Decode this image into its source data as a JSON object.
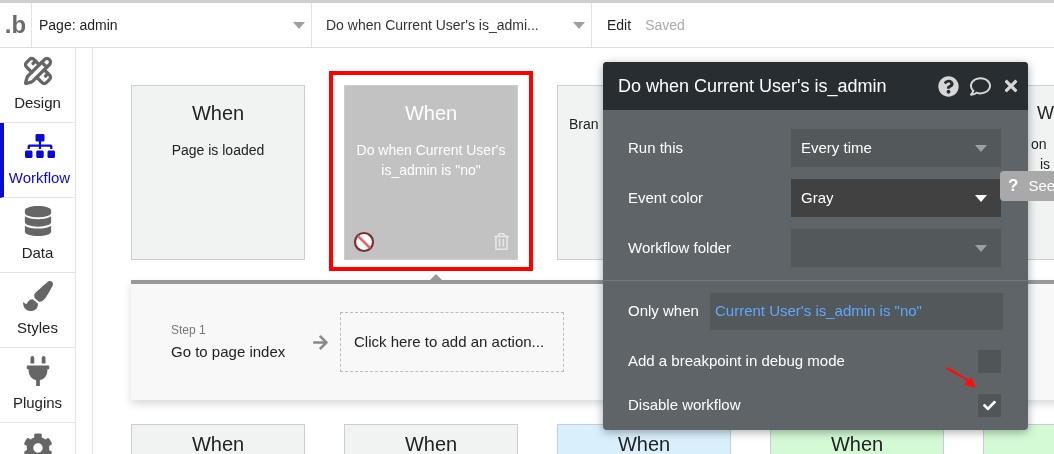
{
  "top_bar": {
    "logo": ".b",
    "page_select": {
      "value": "Page: admin"
    },
    "workflow_select": {
      "value": "Do when Current User's is_admi..."
    },
    "menu": [
      {
        "label": "Edit",
        "disabled": false
      },
      {
        "label": "Saved",
        "disabled": true
      }
    ]
  },
  "sidebar": {
    "items": [
      {
        "label": "Design",
        "selected": false,
        "kind": "design"
      },
      {
        "label": "Workflow",
        "selected": true,
        "kind": "workflow"
      },
      {
        "label": "Data",
        "selected": false,
        "kind": "data"
      },
      {
        "label": "Styles",
        "selected": false,
        "kind": "styles"
      },
      {
        "label": "Plugins",
        "selected": false,
        "kind": "plugins"
      }
    ]
  },
  "event_cards": [
    {
      "kind": "full",
      "title": "When",
      "subtitle": "Page is loaded",
      "disabled": false,
      "selected": false
    },
    {
      "kind": "full",
      "title": "When",
      "subtitle": "Do when Current User's is_admin is \"no\"",
      "disabled": true,
      "selected": true
    },
    {
      "kind": "full",
      "subtitle": "Bran",
      "disabled": false,
      "selected": false
    },
    {
      "kind": "hidden"
    },
    {
      "kind": "clipped",
      "title": "W",
      "lines": [
        "on",
        "is"
      ]
    }
  ],
  "step_panel": {
    "steps": [
      {
        "number": "Step 1",
        "action": "Go to page index"
      }
    ],
    "add_action": "Click here to add an action..."
  },
  "bottom_cards": [
    {
      "kind": "full",
      "title": "When",
      "color": "#f1f2f2"
    },
    {
      "kind": "full",
      "title": "When",
      "color": "#f1f2f2"
    },
    {
      "kind": "full",
      "title": "When",
      "color": "#d9f0fc"
    },
    {
      "kind": "full",
      "title": "When",
      "color": "#d3fad5"
    },
    {
      "kind": "hidden",
      "color": "#d3fad5"
    }
  ],
  "event_panel": {
    "title": "Do when Current User's is_admin",
    "dropdowns": [
      {
        "label": "Run this",
        "value": "Every time",
        "active": false
      },
      {
        "label": "Event color",
        "value": "Gray",
        "active": true
      },
      {
        "label": "Workflow folder",
        "active": false
      }
    ],
    "condition": {
      "label": "Only when",
      "value": "Current User's is_admin is \"no\""
    },
    "checkboxes": [
      {
        "label": "Add a breakpoint in debug mode",
        "checked": false
      },
      {
        "label": "Disable workflow",
        "checked": true
      }
    ]
  },
  "tooltip": {
    "icon": "?",
    "text": "See"
  }
}
